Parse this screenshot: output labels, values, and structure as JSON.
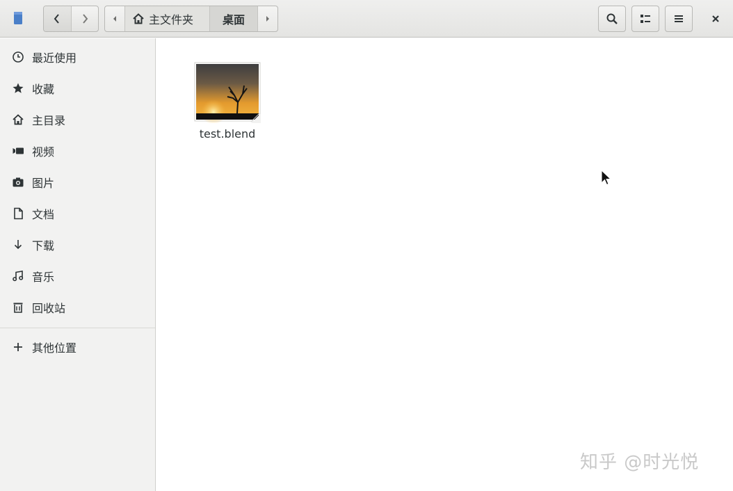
{
  "header": {
    "path": {
      "home_label": "主文件夹",
      "current_label": "桌面"
    }
  },
  "sidebar": {
    "items": [
      {
        "label": "最近使用",
        "icon": "clock-icon"
      },
      {
        "label": "收藏",
        "icon": "star-icon"
      },
      {
        "label": "主目录",
        "icon": "home-icon"
      },
      {
        "label": "视频",
        "icon": "video-icon"
      },
      {
        "label": "图片",
        "icon": "camera-icon"
      },
      {
        "label": "文档",
        "icon": "document-icon"
      },
      {
        "label": "下载",
        "icon": "download-icon"
      },
      {
        "label": "音乐",
        "icon": "music-icon"
      },
      {
        "label": "回收站",
        "icon": "trash-icon"
      }
    ],
    "other_locations": {
      "label": "其他位置",
      "icon": "plus-icon"
    }
  },
  "content": {
    "files": [
      {
        "name": "test.blend",
        "icon": "image-thumbnail-icon"
      }
    ]
  },
  "watermark": "知乎 @时光悦"
}
